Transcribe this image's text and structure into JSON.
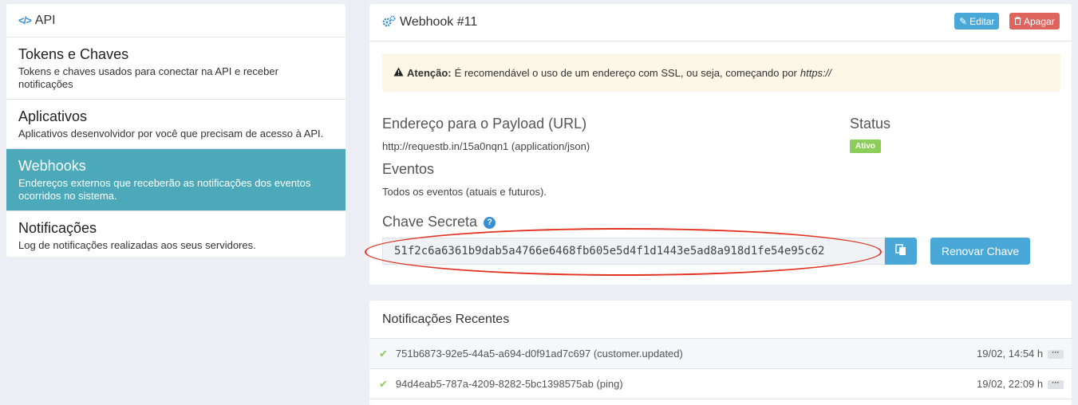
{
  "sidebar": {
    "header": "API",
    "items": [
      {
        "title": "Tokens e Chaves",
        "desc": "Tokens e chaves usados para conectar na API e receber notificações"
      },
      {
        "title": "Aplicativos",
        "desc": "Aplicativos desenvolvidor por você que precisam de acesso à API."
      },
      {
        "title": "Webhooks",
        "desc": "Endereços externos que receberão as notificações dos eventos ocorridos no sistema."
      },
      {
        "title": "Notificações",
        "desc": "Log de notificações realizadas aos seus servidores."
      }
    ],
    "active_index": 2
  },
  "webhook": {
    "title": "Webhook #11",
    "edit_label": "Editar",
    "delete_label": "Apagar",
    "alert": {
      "prefix": "Atenção:",
      "text": "É recomendável o uso de um endereço com SSL, ou seja, começando por",
      "emphasis": "https://"
    },
    "payload_label": "Endereço para o Payload (URL)",
    "payload_value": "http://requestb.in/15a0nqn1 (application/json)",
    "status_label": "Status",
    "status_value": "Ativo",
    "events_label": "Eventos",
    "events_value": "Todos os eventos (atuais e futuros).",
    "secret_label": "Chave Secreta",
    "secret_value": "51f2c6a6361b9dab5a4766e6468fb605e5d4f1d1443e5ad8a918d1fe54e95c62",
    "renew_label": "Renovar Chave"
  },
  "notifications": {
    "title": "Notificações Recentes",
    "rows": [
      {
        "id": "751b6873-92e5-44a5-a694-d0f91ad7c697 (customer.updated)",
        "time": "19/02, 14:54 h"
      },
      {
        "id": "94d4eab5-787a-4209-8282-5bc1398575ab (ping)",
        "time": "19/02, 22:09 h"
      }
    ]
  },
  "colors": {
    "accent": "#4aa8d8",
    "active_item": "#4ba9b9",
    "danger": "#e0645e",
    "success": "#8dcd5a",
    "annotation": "#e3321f"
  },
  "icons": [
    "code-icon",
    "gears-icon",
    "pencil-icon",
    "trash-icon",
    "warning-icon",
    "help-icon",
    "copy-icon",
    "check-icon",
    "ellipsis-icon"
  ]
}
